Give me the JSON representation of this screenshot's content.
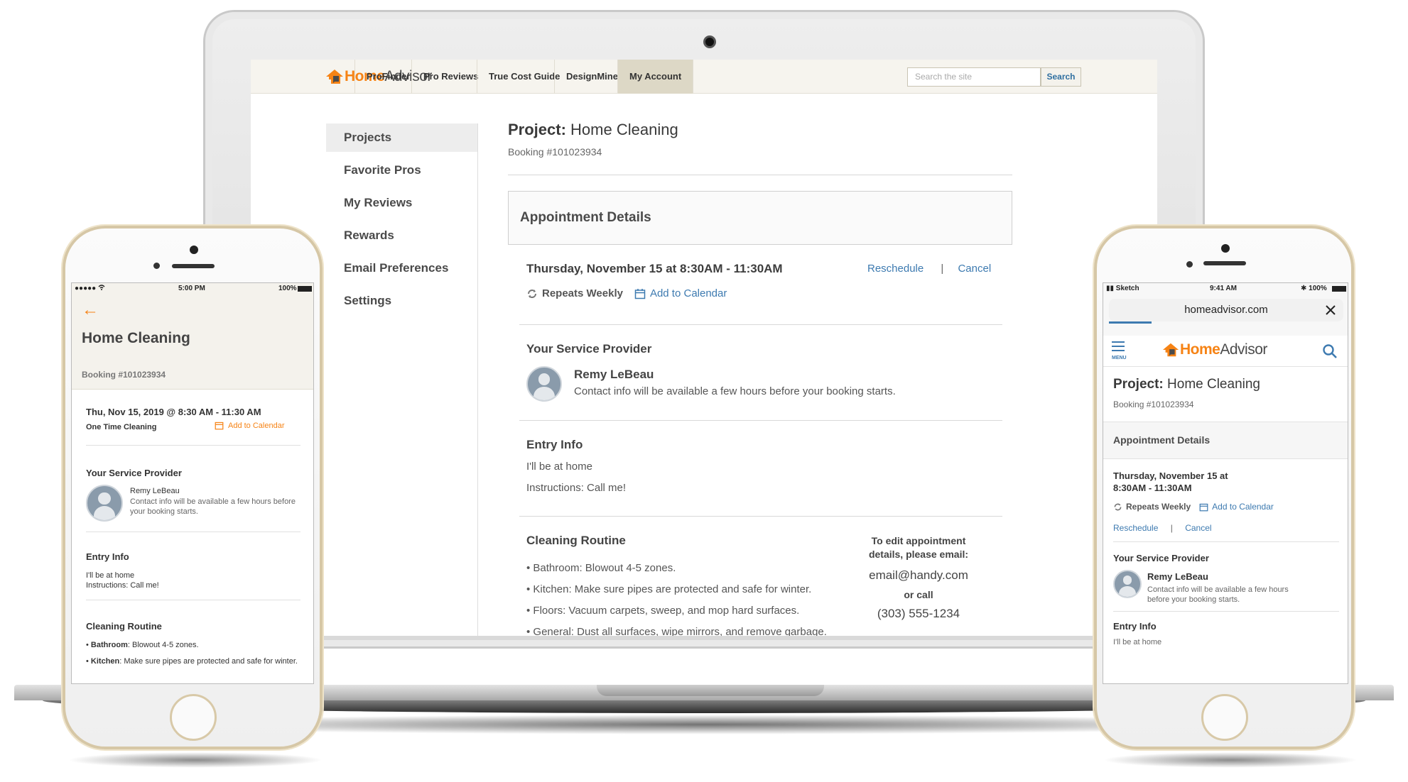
{
  "brand": {
    "name_part1": "Home",
    "name_part2": "Advisor",
    "accent_color": "#f68315",
    "link_color": "#3d7ab0"
  },
  "nav": {
    "tabs": [
      {
        "label": "ProFinder"
      },
      {
        "label": "Pro Reviews"
      },
      {
        "label": "True Cost Guide"
      },
      {
        "label": "DesignMine"
      },
      {
        "label": "My Account"
      }
    ],
    "active_tab": "My Account",
    "search_placeholder": "Search the site",
    "search_button": "Search"
  },
  "sidebar": {
    "items": [
      {
        "label": "Projects"
      },
      {
        "label": "Favorite Pros"
      },
      {
        "label": "My Reviews"
      },
      {
        "label": "Rewards"
      },
      {
        "label": "Email Preferences"
      },
      {
        "label": "Settings"
      }
    ],
    "active": "Projects"
  },
  "project": {
    "title_prefix": "Project:",
    "title": "Home Cleaning",
    "booking": "Booking #101023934"
  },
  "appointment": {
    "heading": "Appointment Details",
    "datetime": "Thursday, November 15 at 8:30AM - 11:30AM",
    "reschedule": "Reschedule",
    "separator": "|",
    "cancel": "Cancel",
    "repeats": "Repeats Weekly",
    "add_to_calendar": "Add to Calendar"
  },
  "provider": {
    "heading": "Your Service Provider",
    "name": "Remy LeBeau",
    "note": "Contact info will be available a few hours before your booking starts."
  },
  "entry": {
    "heading": "Entry Info",
    "line1": "I'll be at home",
    "line2": "Instructions: Call me!"
  },
  "routine": {
    "heading": "Cleaning Routine",
    "items": [
      "• Bathroom: Blowout 4-5 zones.",
      "• Kitchen: Make sure pipes are protected and safe for winter.",
      "• Floors: Vacuum carpets, sweep, and mop hard surfaces.",
      "• General: Dust all surfaces, wipe mirrors, and remove garbage."
    ]
  },
  "contact": {
    "edit_line1": "To edit appointment",
    "edit_line2": "details, please email:",
    "email": "email@handy.com",
    "or_call": "or call",
    "phone": "(303) 555-1234"
  },
  "left_phone": {
    "status": {
      "signal": "●●●●● ",
      "time": "5:00 PM",
      "battery": "100%"
    },
    "back_arrow": "←",
    "title": "Home Cleaning",
    "booking": "Booking #101023934",
    "datetime": "Thu, Nov 15, 2019 @ 8:30 AM - 11:30 AM",
    "frequency": "One Time Cleaning",
    "add_to_calendar": "Add to Calendar",
    "provider_heading": "Your Service Provider",
    "provider_name": "Remy LeBeau",
    "provider_note": "Contact info will be available a few hours before your booking starts.",
    "entry_heading": "Entry Info",
    "entry_line1": "I'll be at home",
    "entry_line2": "Instructions: Call me!",
    "routine_heading": "Cleaning Routine",
    "routine_items": [
      {
        "label": "Bathroom",
        "text": ": Blowout 4-5 zones."
      },
      {
        "label": "Kitchen",
        "text": ": Make sure pipes are protected and safe for winter."
      }
    ]
  },
  "right_phone": {
    "status": {
      "carrier": "Sketch",
      "time": "9:41 AM",
      "battery": "100%"
    },
    "url": "homeadvisor.com",
    "menu_label": "MENU",
    "title_prefix": "Project:",
    "title": "Home Cleaning",
    "booking": "Booking #101023934",
    "appointment_heading": "Appointment Details",
    "datetime_line1": "Thursday, November 15 at",
    "datetime_line2": "8:30AM - 11:30AM",
    "repeats": "Repeats Weekly",
    "add_to_calendar": "Add to Calendar",
    "reschedule": "Reschedule",
    "separator": "|",
    "cancel": "Cancel",
    "provider_heading": "Your Service Provider",
    "provider_name": "Remy LeBeau",
    "provider_note_line1": "Contact info will be available a few hours",
    "provider_note_line2": "before your booking starts.",
    "entry_heading": "Entry Info",
    "entry_line1": "I'll be at home"
  }
}
